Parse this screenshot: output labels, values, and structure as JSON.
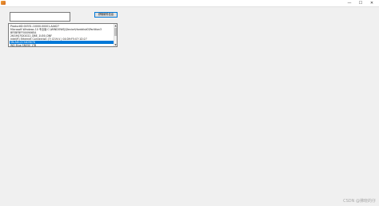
{
  "window": {
    "title": "",
    "controls": {
      "minimize": "—",
      "maximize": "☐",
      "close": "✕"
    }
  },
  "input": {
    "value": ""
  },
  "button": {
    "label": "获取硬件信息"
  },
  "list": {
    "items": [
      "ProductID:00331-10000-00001-AA627",
      "Microsoft Windows 10 专业版 C:\\WINDOWS|\\Device\\Harddisk0\\Partition3",
      "BFEBFBFF000906EA",
      "2KG9Q7SX2022_DBE_1U00_DNF",
      "Intel(R) Ethernet Connection (7) I219-V | 04:D9:F5:07:1D:27",
      "SN:AB12C34D5678",
      "WD Blue SN550 1TB"
    ],
    "selected_index": 5
  },
  "scrollbar": {
    "up_arrow": "▲",
    "down_arrow": "▼"
  },
  "watermark": {
    "text": "CSDN @拂晓的仔"
  }
}
